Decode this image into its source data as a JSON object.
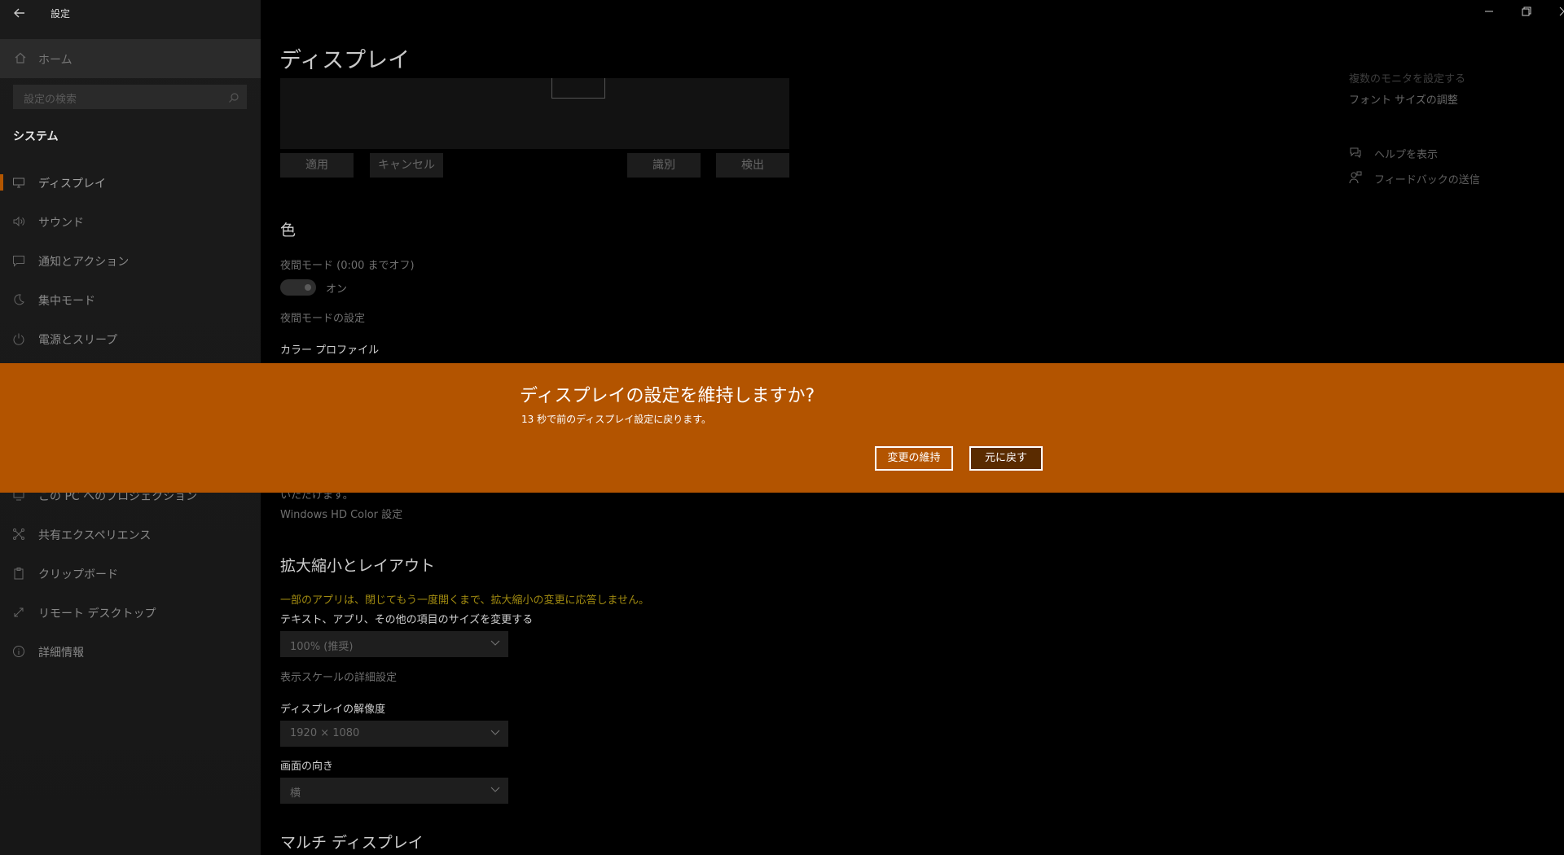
{
  "window": {
    "title": "設定",
    "controls": [
      "minimize",
      "restore",
      "close"
    ]
  },
  "sidebar": {
    "home": "ホーム",
    "search_placeholder": "設定の検索",
    "section": "システム",
    "items": [
      {
        "label": "ディスプレイ",
        "icon": "monitor-icon",
        "selected": true
      },
      {
        "label": "サウンド",
        "icon": "speaker-icon"
      },
      {
        "label": "通知とアクション",
        "icon": "message-icon"
      },
      {
        "label": "集中モード",
        "icon": "moon-icon"
      },
      {
        "label": "電源とスリープ",
        "icon": "power-icon"
      },
      {
        "label": "この PC へのプロジェクション",
        "icon": "projection-icon"
      },
      {
        "label": "共有エクスペリエンス",
        "icon": "share-icon"
      },
      {
        "label": "クリップボード",
        "icon": "clipboard-icon"
      },
      {
        "label": "リモート デスクトップ",
        "icon": "remote-icon"
      },
      {
        "label": "詳細情報",
        "icon": "info-icon"
      }
    ]
  },
  "main": {
    "title": "ディスプレイ",
    "buttons": {
      "apply": "適用",
      "cancel": "キャンセル",
      "identify": "識別",
      "detect": "検出"
    },
    "color_section": {
      "heading": "色",
      "night_light": "夜間モード (0:00 までオフ)",
      "toggle_state": "オン",
      "night_light_settings": "夜間モードの設定",
      "color_profile": "カラー プロファイル"
    },
    "hd_partial": "いただけます。",
    "hd_color_link": "Windows HD Color 設定",
    "scale_section": {
      "heading": "拡大縮小とレイアウト",
      "warning": "一部のアプリは、閉じてもう一度開くまで、拡大縮小の変更に応答しません。",
      "size_label": "テキスト、アプリ、その他の項目のサイズを変更する",
      "size_value": "100% (推奨)",
      "advanced_link": "表示スケールの詳細設定",
      "resolution_label": "ディスプレイの解像度",
      "resolution_value": "1920 × 1080",
      "orientation_label": "画面の向き",
      "orientation_value": "横"
    },
    "multi_display": "マルチ ディスプレイ"
  },
  "right_panel": {
    "partial_link": "複数のモニタを設定する",
    "font_size_link": "フォント サイズの調整",
    "help": "ヘルプを表示",
    "feedback": "フィードバックの送信"
  },
  "banner": {
    "title": "ディスプレイの設定を維持しますか?",
    "message": "13 秒で前のディスプレイ設定に戻ります。",
    "keep": "変更の維持",
    "revert": "元に戻す",
    "color": "#b35400"
  }
}
